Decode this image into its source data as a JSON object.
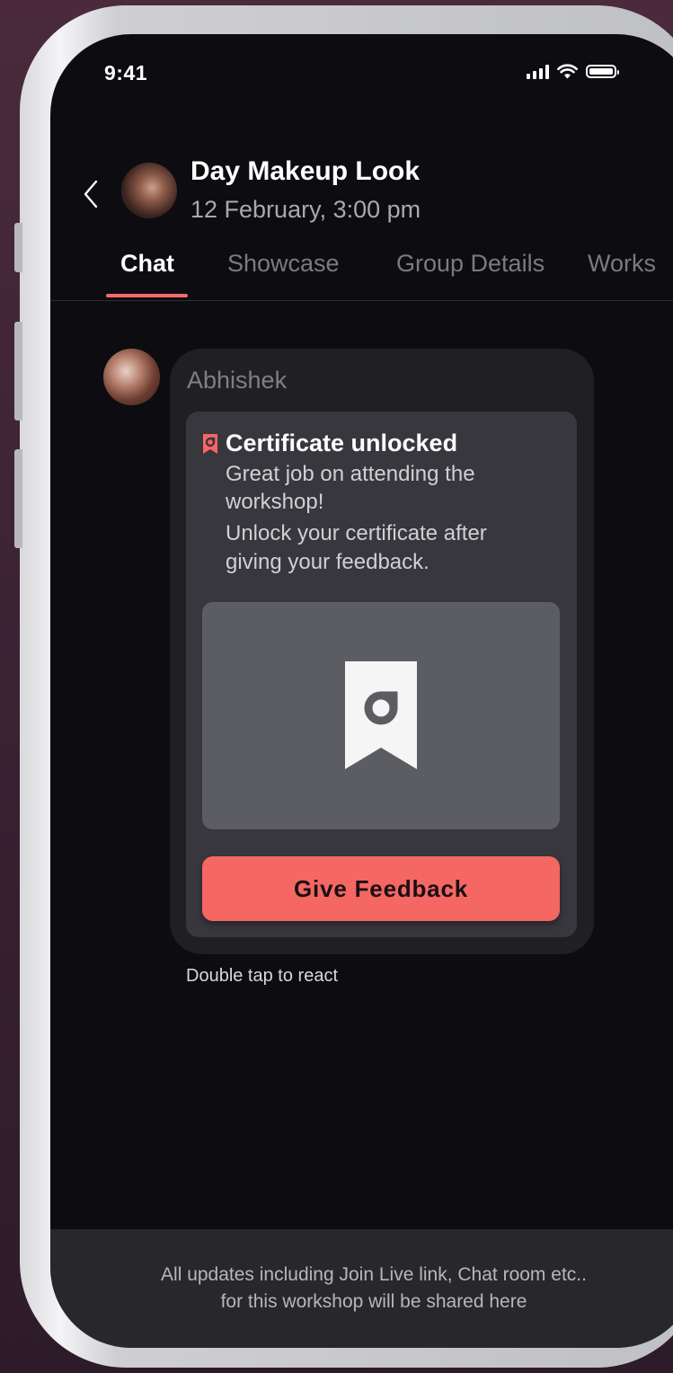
{
  "status_bar": {
    "time": "9:41",
    "icons": [
      "signal-icon",
      "wifi-icon",
      "battery-icon"
    ]
  },
  "header": {
    "title": "Day Makeup Look",
    "subtitle": "12 February, 3:00 pm"
  },
  "tabs": [
    {
      "label": "Chat",
      "active": true
    },
    {
      "label": "Showcase",
      "active": false
    },
    {
      "label": "Group Details",
      "active": false
    },
    {
      "label": "Works",
      "active": false
    }
  ],
  "message": {
    "sender": "Abhishek",
    "card": {
      "title": "Certificate unlocked",
      "body_lines": [
        "Great job on attending the",
        "workshop!",
        "Unlock your certificate after",
        "giving your feedback."
      ],
      "button_label": "Give Feedback"
    },
    "react_hint": "Double tap to react"
  },
  "footer": {
    "lines": [
      "All updates including Join Live link, Chat room etc..",
      "for this workshop will be shared here"
    ]
  },
  "colors": {
    "accent": "#f56763",
    "screen_bg": "#0d0d11",
    "bubble_bg": "#1f1f24",
    "card_bg": "#37373d"
  }
}
